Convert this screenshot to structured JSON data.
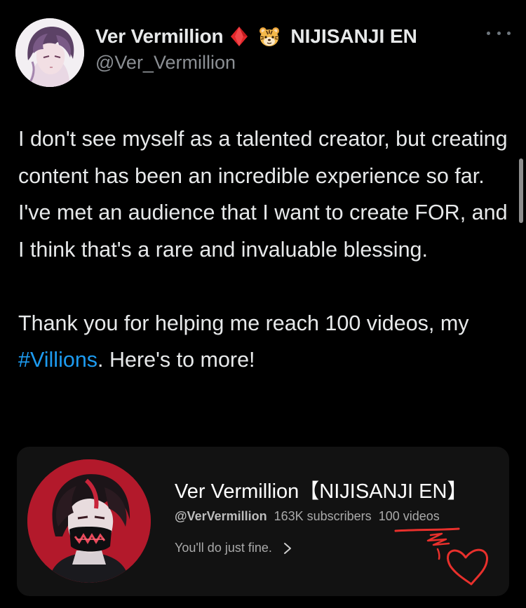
{
  "tweet": {
    "author": {
      "display_name": "Ver Vermillion",
      "org": "NIJISANJI EN",
      "handle": "@Ver_Vermillion",
      "avatar_icon": "anime-avatar-icon",
      "badges": [
        "red-diamond-icon",
        "tiger-face-icon"
      ]
    },
    "text_parts": {
      "before_hashtag": "I don't see myself as a talented creator, but creating content has been an incredible experience so far. I've met an audience that I want to create FOR, and I think that's a rare and invaluable blessing.\n\nThank you for helping me reach 100 videos, my ",
      "hashtag": "#Villions",
      "after_hashtag": ". Here's to more!"
    }
  },
  "card": {
    "title": "Ver Vermillion【NIJISANJI EN】",
    "handle": "@VerVermillion",
    "subscribers": "163K subscribers",
    "videos": "100 videos",
    "description": "You'll do just fine.",
    "annotation": "red-underline-and-heart-drawing"
  },
  "colors": {
    "background": "#000000",
    "text": "#e7e9ea",
    "secondary_text": "#8b8f94",
    "hashtag": "#1d9bf0",
    "card_background": "#121212",
    "annotation_red": "#e8302c"
  }
}
